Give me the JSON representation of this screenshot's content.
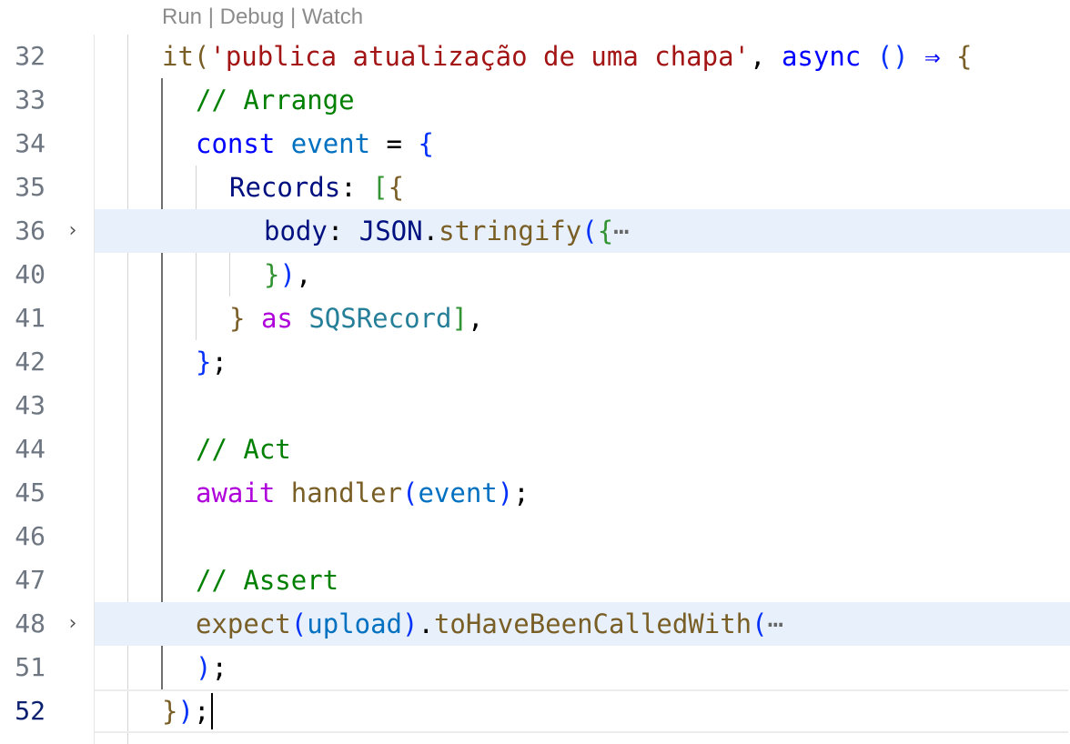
{
  "codelens": {
    "run": "Run",
    "debug": "Debug",
    "watch": "Watch",
    "separator": "|"
  },
  "lines": [
    {
      "number": "32",
      "tokens": [
        "it",
        "(",
        "'publica atualização de uma chapa'",
        ", ",
        "async",
        " ",
        "()",
        " ⇒ ",
        "{"
      ]
    },
    {
      "number": "33",
      "tokens": [
        "// Arrange"
      ]
    },
    {
      "number": "34",
      "tokens": [
        "const",
        " ",
        "event",
        " = ",
        "{"
      ]
    },
    {
      "number": "35",
      "tokens": [
        "Records",
        ": ",
        "[",
        "{"
      ]
    },
    {
      "number": "36",
      "tokens": [
        "body",
        ": ",
        "JSON",
        ".",
        "stringify",
        "(",
        "{",
        "⋯"
      ],
      "folded": true
    },
    {
      "number": "40",
      "tokens": [
        "}",
        ")",
        ","
      ]
    },
    {
      "number": "41",
      "tokens": [
        "}",
        " ",
        "as",
        " ",
        "SQSRecord",
        "]",
        ","
      ]
    },
    {
      "number": "42",
      "tokens": [
        "}",
        ";"
      ]
    },
    {
      "number": "43",
      "tokens": []
    },
    {
      "number": "44",
      "tokens": [
        "// Act"
      ]
    },
    {
      "number": "45",
      "tokens": [
        "await",
        " ",
        "handler",
        "(",
        "event",
        ")",
        ";"
      ]
    },
    {
      "number": "46",
      "tokens": []
    },
    {
      "number": "47",
      "tokens": [
        "// Assert"
      ]
    },
    {
      "number": "48",
      "tokens": [
        "expect",
        "(",
        "upload",
        ")",
        ".",
        "toHaveBeenCalledWith",
        "(",
        "⋯"
      ],
      "folded": true
    },
    {
      "number": "51",
      "tokens": [
        ")",
        ";"
      ]
    },
    {
      "number": "52",
      "tokens": [
        "}",
        ")",
        ";"
      ],
      "current": true
    }
  ],
  "icons": {
    "fold": "chevron-right-icon"
  }
}
